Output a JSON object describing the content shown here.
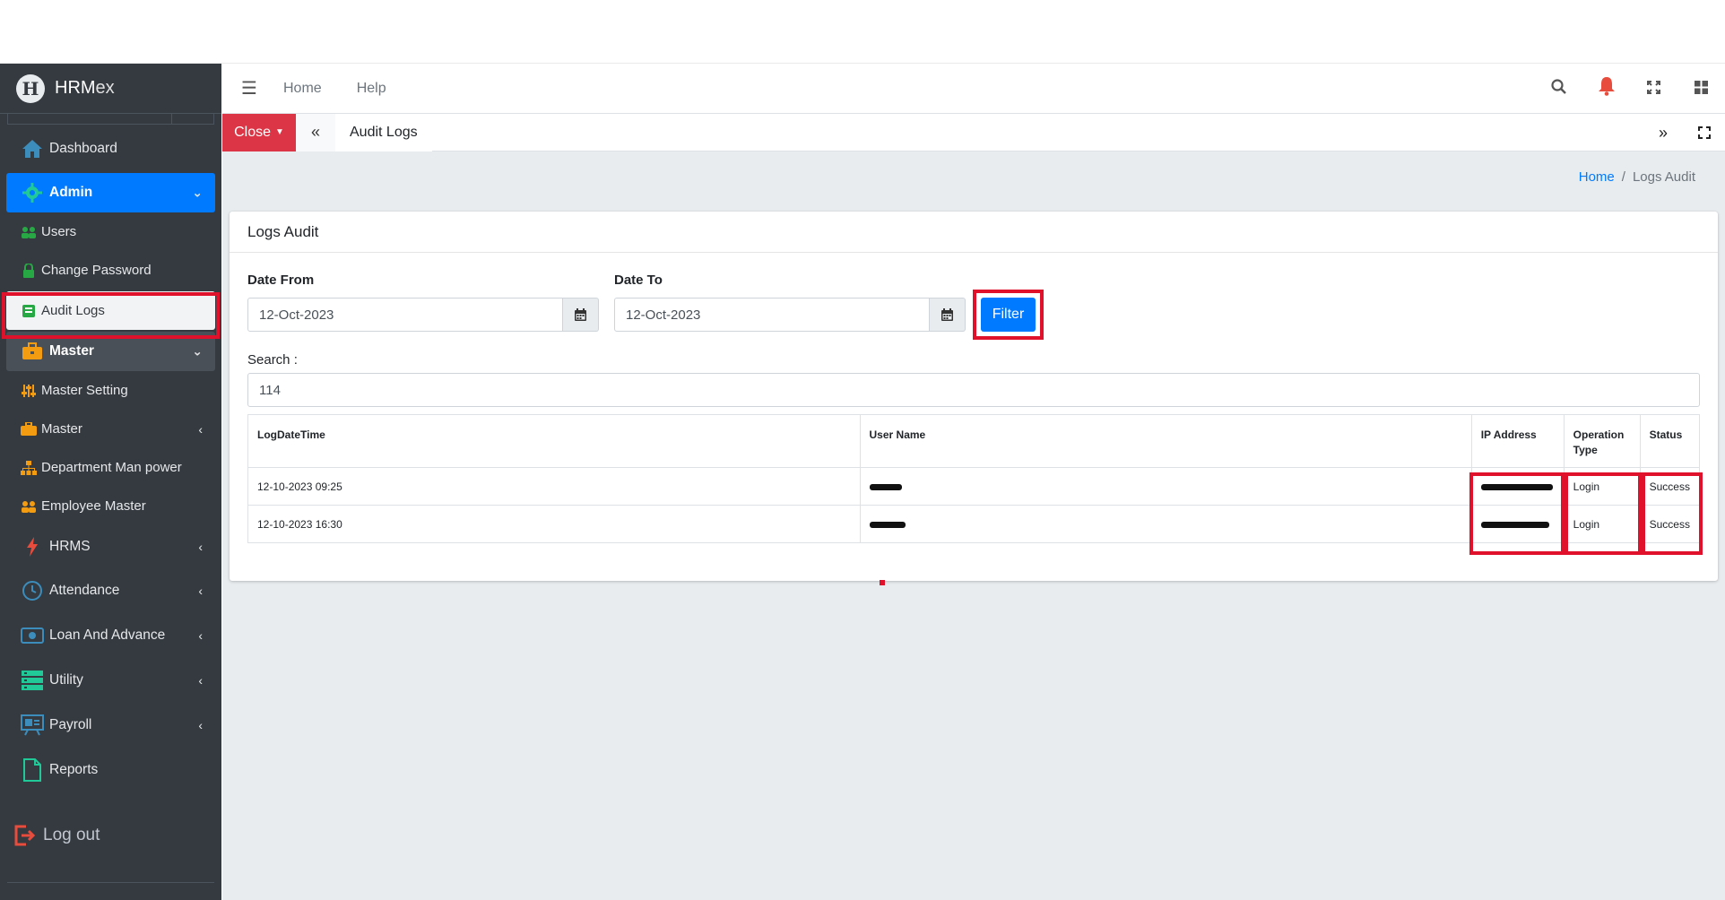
{
  "brand": {
    "logo_letter": "H",
    "name_part1": "HRM",
    "name_part2": "ex"
  },
  "sidebar": {
    "items": [
      {
        "label": "Dashboard",
        "icon": "home-icon",
        "color": "#3c8dbc"
      },
      {
        "label": "Admin",
        "icon": "gear-icon",
        "color": "#20c997"
      },
      {
        "label": "Users",
        "icon": "users-icon",
        "color": "#28a745"
      },
      {
        "label": "Change Password",
        "icon": "lock-icon",
        "color": "#28a745"
      },
      {
        "label": "Audit Logs",
        "icon": "log-icon",
        "color": "#28a745"
      },
      {
        "label": "Master",
        "icon": "briefcase-icon",
        "color": "#f39c12"
      },
      {
        "label": "Master Setting",
        "icon": "sliders-icon",
        "color": "#f39c12"
      },
      {
        "label": "Master",
        "icon": "briefcase-icon",
        "color": "#f39c12"
      },
      {
        "label": "Department Man power",
        "icon": "sitemap-icon",
        "color": "#f39c12"
      },
      {
        "label": "Employee Master",
        "icon": "users-icon",
        "color": "#f39c12"
      },
      {
        "label": "HRMS",
        "icon": "bolt-icon",
        "color": "#e74c3c"
      },
      {
        "label": "Attendance",
        "icon": "clock-icon",
        "color": "#3c8dbc"
      },
      {
        "label": "Loan And Advance",
        "icon": "money-icon",
        "color": "#3c8dbc"
      },
      {
        "label": "Utility",
        "icon": "server-icon",
        "color": "#20c997"
      },
      {
        "label": "Payroll",
        "icon": "presentation-icon",
        "color": "#3c8dbc"
      },
      {
        "label": "Reports",
        "icon": "file-icon",
        "color": "#20c997"
      }
    ],
    "logout_label": "Log out"
  },
  "topnav": {
    "home": "Home",
    "help": "Help"
  },
  "tabbar": {
    "close_label": "Close",
    "active_tab": "Audit Logs"
  },
  "breadcrumb": {
    "home": "Home",
    "current": "Logs Audit"
  },
  "card": {
    "title": "Logs Audit",
    "date_from_label": "Date From",
    "date_from_value": "12-Oct-2023",
    "date_to_label": "Date To",
    "date_to_value": "12-Oct-2023",
    "filter_label": "Filter",
    "search_label": "Search :",
    "search_value": "114"
  },
  "table": {
    "headers": [
      "LogDateTime",
      "User Name",
      "IP Address",
      "Operation Type",
      "Status"
    ],
    "rows": [
      {
        "datetime": "12-10-2023 09:25",
        "operation": "Login",
        "status": "Success"
      },
      {
        "datetime": "12-10-2023 16:30",
        "operation": "Login",
        "status": "Success"
      }
    ]
  },
  "colors": {
    "accent": "#007bff",
    "danger": "#dc3545",
    "highlight": "#e0112b",
    "sidebar_bg": "#343a40"
  }
}
